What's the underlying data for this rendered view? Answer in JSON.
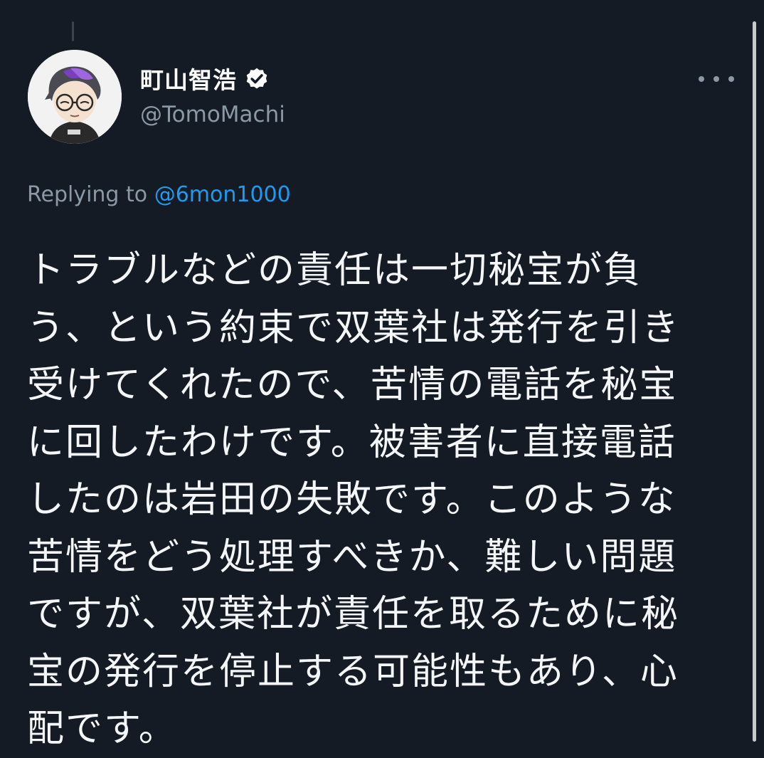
{
  "author": {
    "display_name": "町山智浩",
    "handle": "@TomoMachi",
    "verified": true,
    "avatar_icon": "avatar-illustration"
  },
  "reply": {
    "prefix": "Replying to",
    "mention": "@6mon1000"
  },
  "tweet": {
    "text": "トラブルなどの責任は一切秘宝が負\nう、という約束で双葉社は発行を引き\n受けてくれたので、苦情の電話を秘宝\nに回したわけです。被害者に直接電話\nしたのは岩田の失敗です。このような\n苦情をどう処理すべきか、難しい問題\nですが、双葉社が責任を取るために秘\n宝の発行を停止する可能性もあり、心\n配です。"
  },
  "icons": {
    "verified": "verified-badge-icon",
    "more": "more-options-icon"
  },
  "colors": {
    "background": "#151b25",
    "link": "#1d9bf0",
    "secondary_text": "#8b98a5",
    "primary_text": "#f5f6f7"
  }
}
